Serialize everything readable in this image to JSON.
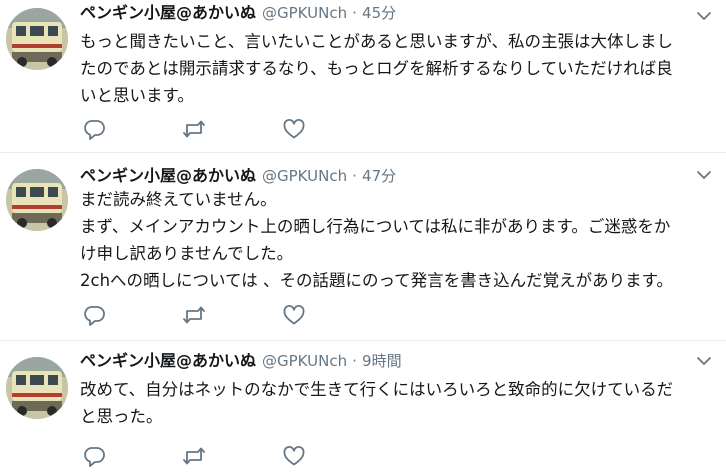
{
  "tweets": [
    {
      "name": "ペンギン小屋@あかいぬ",
      "handle": "@GPKUNch",
      "separator": "·",
      "time": "45分",
      "lines": [
        "もっと聞きたいこと、言いたいことがあると思いますが、私の主張は大体しまし",
        "たのであとは開示請求するなり、もっとログを解析するなりしていただければ良",
        "いと思います。"
      ]
    },
    {
      "name": "ペンギン小屋@あかいぬ",
      "handle": "@GPKUNch",
      "separator": "·",
      "time": "47分",
      "lines": [
        "まだ読み終えていません。",
        "まず、メインアカウント上の晒し行為については私に非があります。ご迷惑をか",
        "け申し訳ありませんでした。",
        "2chへの晒しについては 、その話題にのって発言を書き込んだ覚えがあります。"
      ]
    },
    {
      "name": "ペンギン小屋@あかいぬ",
      "handle": "@GPKUNch",
      "separator": "·",
      "time": "9時間",
      "lines": [
        "改めて、自分はネットのなかで生きて行くにはいろいろと致命的に欠けているだ",
        "と思った。"
      ]
    }
  ],
  "icons": {
    "avatar": "avatar-photo",
    "caret": "chevron-down-icon",
    "reply": "reply-icon",
    "retweet": "retweet-icon",
    "like": "heart-icon"
  },
  "colors": {
    "text": "#14171a",
    "secondary": "#657786",
    "divider": "#e6ecf0"
  }
}
